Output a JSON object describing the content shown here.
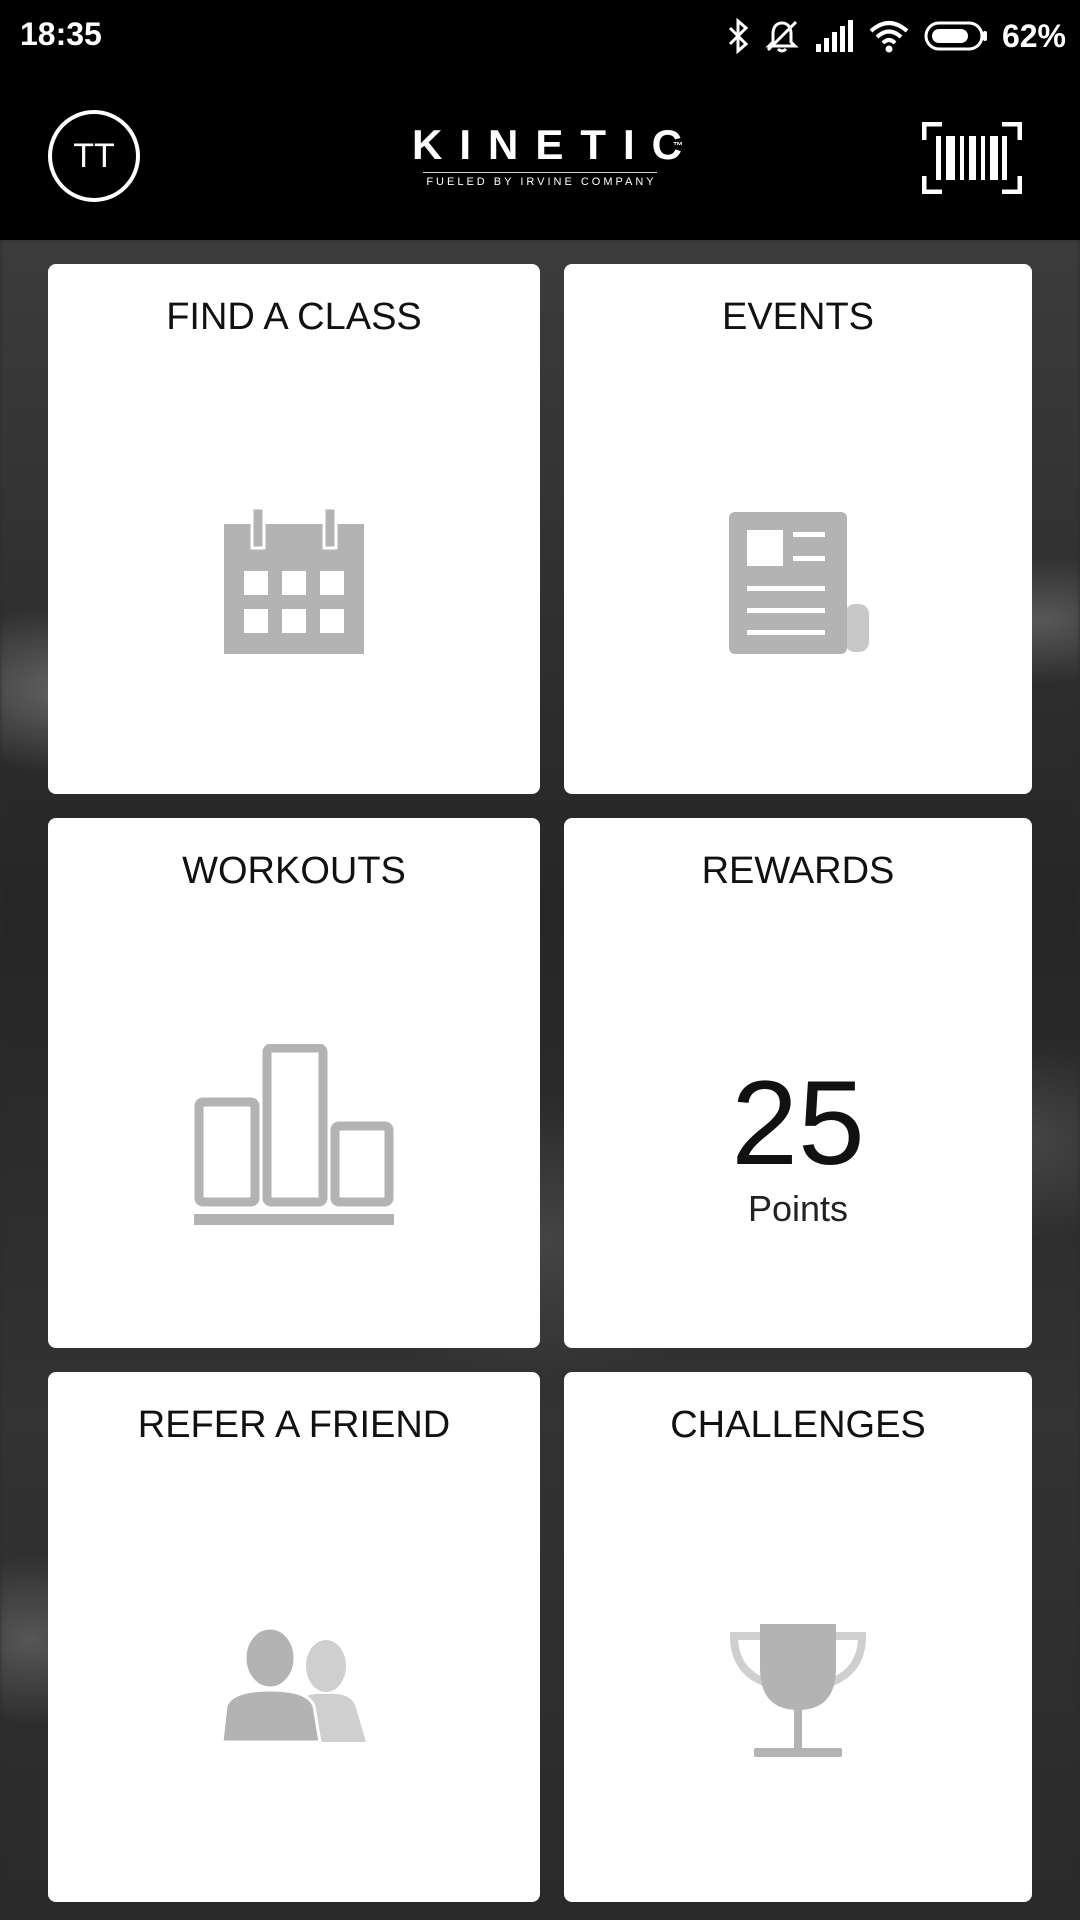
{
  "status_bar": {
    "time": "18:35",
    "battery_percent": "62%",
    "icons": [
      "bluetooth-icon",
      "muted-bell-icon",
      "signal-icon",
      "wifi-icon",
      "battery-icon"
    ]
  },
  "header": {
    "avatar_initials": "TT",
    "logo_text": "KINETIC",
    "logo_trademark": "™",
    "logo_tagline": "FUELED BY IRVINE COMPANY",
    "barcode_icon": "barcode-scan-icon"
  },
  "tiles": {
    "find_class": {
      "title": "FIND A CLASS",
      "icon": "calendar-icon"
    },
    "events": {
      "title": "EVENTS",
      "icon": "newspaper-icon"
    },
    "workouts": {
      "title": "WORKOUTS",
      "icon": "bar-chart-icon"
    },
    "rewards": {
      "title": "REWARDS",
      "points": "25",
      "points_label": "Points"
    },
    "refer": {
      "title": "REFER A FRIEND",
      "icon": "people-icon"
    },
    "challenges": {
      "title": "CHALLENGES",
      "icon": "trophy-icon"
    }
  },
  "colors": {
    "icon_gray": "#b3b3b3",
    "header_bg": "#000000",
    "tile_bg": "#ffffff"
  }
}
